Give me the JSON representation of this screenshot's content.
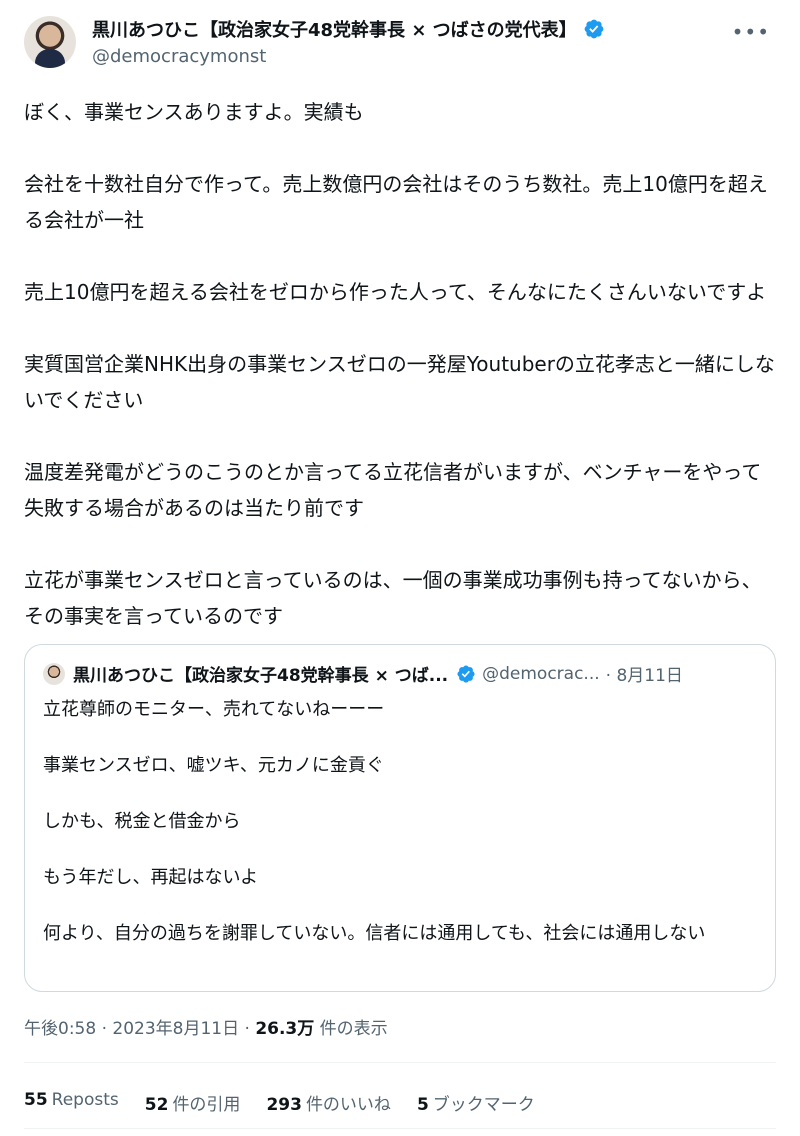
{
  "author": {
    "display_name": "黒川あつひこ【政治家女子48党幹事長 × つばさの党代表】",
    "handle": "@democracymonst"
  },
  "post": {
    "paragraphs": [
      "ぼく、事業センスありますよ。実績も",
      "会社を十数社自分で作って。売上数億円の会社はそのうち数社。売上10億円を超える会社が一社",
      "売上10億円を超える会社をゼロから作った人って、そんなにたくさんいないですよ",
      "実質国営企業NHK出身の事業センスゼロの一発屋Youtuberの立花孝志と一緒にしないでください",
      "温度差発電がどうのこうのとか言ってる立花信者がいますが、ベンチャーをやって失敗する場合があるのは当たり前です",
      "立花が事業センスゼロと言っているのは、一個の事業成功事例も持ってないから、その事実を言っているのです"
    ]
  },
  "quoted": {
    "display_name": "黒川あつひこ【政治家女子48党幹事長 × つば...",
    "handle": "@democrac...",
    "date": "· 8月11日",
    "paragraphs": [
      "立花尊師のモニター、売れてないねーーー",
      "事業センスゼロ、嘘ツキ、元カノに金貢ぐ",
      "しかも、税金と借金から",
      "もう年だし、再起はないよ",
      "何より、自分の過ちを謝罪していない。信者には通用しても、社会には通用しない"
    ]
  },
  "meta": {
    "time": "午後0:58 · 2023年8月11日 · ",
    "views_count": "26.3万",
    "views_label": " 件の表示"
  },
  "stats": {
    "reposts_count": "55",
    "reposts_label": "Reposts",
    "quotes_count": "52",
    "quotes_label": "件の引用",
    "likes_count": "293",
    "likes_label": "件のいいね",
    "bookmarks_count": "5",
    "bookmarks_label": "ブックマーク"
  },
  "icons": {
    "verified": "verified-badge-icon",
    "more": "more-options-icon"
  },
  "colors": {
    "verified_blue": "#1d9bf0",
    "text": "#0f1419",
    "secondary": "#536471",
    "border": "#cfd9de"
  }
}
